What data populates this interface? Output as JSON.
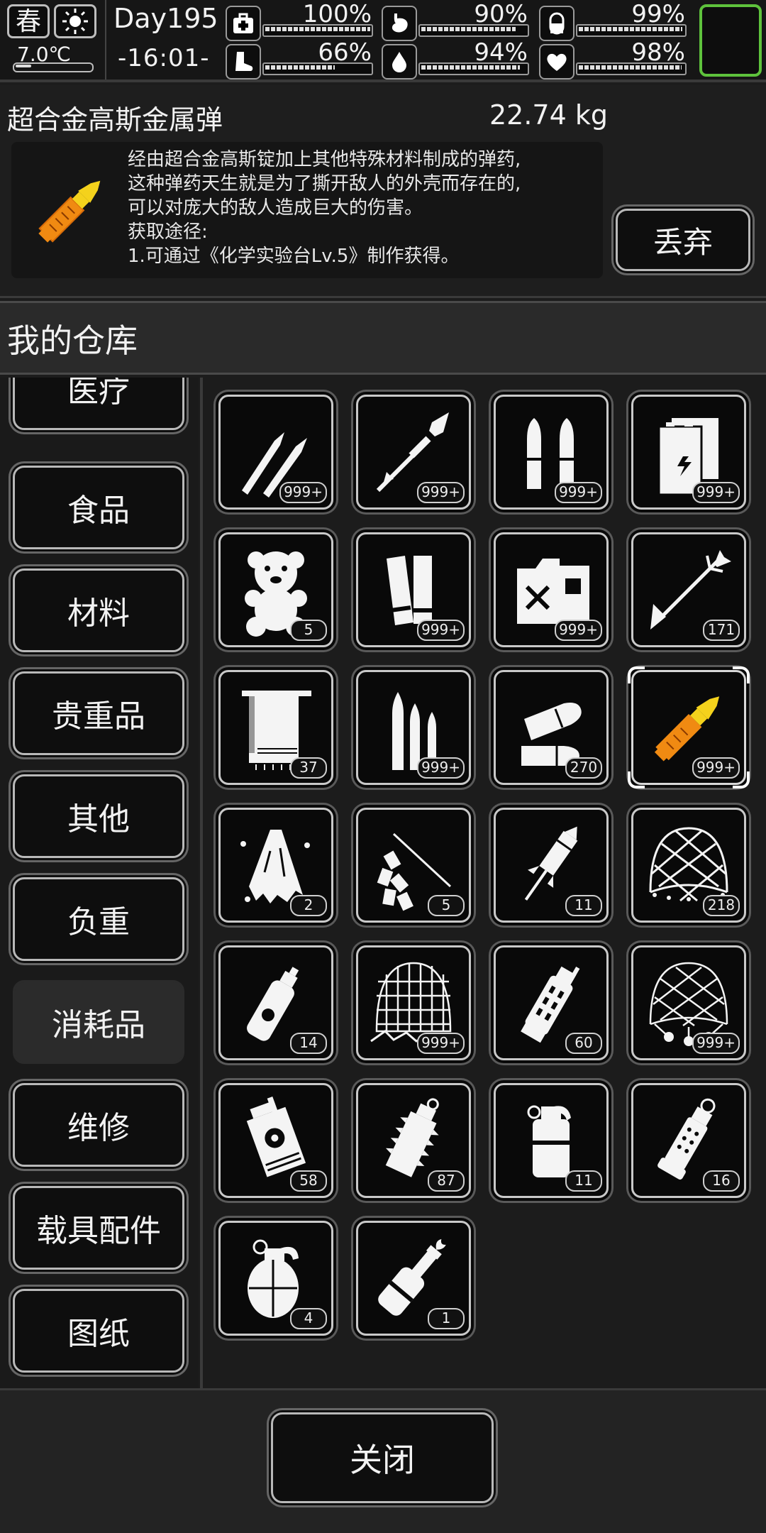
{
  "status": {
    "season": "春",
    "temperature": "7.0℃",
    "day": "Day195",
    "time": "-16:01-",
    "stats": [
      {
        "name": "health",
        "icon": "medkit-icon",
        "value": "100%",
        "level": 100
      },
      {
        "name": "hunger",
        "icon": "stomach-icon",
        "value": "90%",
        "level": 90
      },
      {
        "name": "pill",
        "icon": "pill-icon",
        "value": "99%",
        "level": 99
      },
      {
        "name": "stamina",
        "icon": "boot-icon",
        "value": "66%",
        "level": 66
      },
      {
        "name": "thirst",
        "icon": "water-drop-icon",
        "value": "94%",
        "level": 94
      },
      {
        "name": "mood",
        "icon": "heart-icon",
        "value": "98%",
        "level": 98
      }
    ]
  },
  "detail": {
    "name": "超合金高斯金属弹",
    "weight": "22.74 kg",
    "description": [
      "经由超合金高斯锭加上其他特殊材料制成的弹药,",
      "这种弹药天生就是为了撕开敌人的外壳而存在的,",
      "可以对庞大的敌人造成巨大的伤害。",
      "获取途径:",
      "1.可通过《化学实验台Lv.5》制作获得。"
    ],
    "drop_label": "丢弃"
  },
  "warehouse": {
    "title": "我的仓库",
    "categories": [
      "医疗",
      "食品",
      "材料",
      "贵重品",
      "其他",
      "负重",
      "消耗品",
      "维修",
      "载具配件",
      "图纸"
    ],
    "selected_category": "消耗品",
    "items": [
      {
        "icon": "rifle-rounds-icon",
        "count": "999+"
      },
      {
        "icon": "rocket-spear-icon",
        "count": "999+"
      },
      {
        "icon": "pistol-rounds-icon",
        "count": "999+"
      },
      {
        "icon": "battery-cells-icon",
        "count": "999+"
      },
      {
        "icon": "teddy-bear-icon",
        "count": "5"
      },
      {
        "icon": "shotgun-shells-icon",
        "count": "999+"
      },
      {
        "icon": "fuel-can-icon",
        "count": "999+"
      },
      {
        "icon": "arrow-icon",
        "count": "171"
      },
      {
        "icon": "towel-icon",
        "count": "37"
      },
      {
        "icon": "ammo-cartridges-icon",
        "count": "999+"
      },
      {
        "icon": "slug-rounds-icon",
        "count": "270"
      },
      {
        "icon": "gauss-round-icon",
        "count": "999+",
        "selected": true
      },
      {
        "icon": "torn-cloth-icon",
        "count": "2"
      },
      {
        "icon": "firecrackers-icon",
        "count": "5"
      },
      {
        "icon": "firework-rocket-icon",
        "count": "11"
      },
      {
        "icon": "net-icon",
        "count": "218"
      },
      {
        "icon": "spray-can-icon",
        "count": "14"
      },
      {
        "icon": "net-trap-icon",
        "count": "999+"
      },
      {
        "icon": "stun-grenade-icon",
        "count": "60"
      },
      {
        "icon": "bola-net-icon",
        "count": "999+"
      },
      {
        "icon": "toxic-grenade-icon",
        "count": "58"
      },
      {
        "icon": "spiked-grenade-icon",
        "count": "87"
      },
      {
        "icon": "smoke-grenade-icon",
        "count": "11"
      },
      {
        "icon": "flashbang-icon",
        "count": "16"
      },
      {
        "icon": "frag-grenade-icon",
        "count": "4"
      },
      {
        "icon": "molotov-icon",
        "count": "1"
      }
    ]
  },
  "footer": {
    "close_label": "关闭"
  },
  "colors": {
    "accent_green": "#5ec23c",
    "item_orange": "#f08a12",
    "item_yellow": "#f4d21c"
  }
}
